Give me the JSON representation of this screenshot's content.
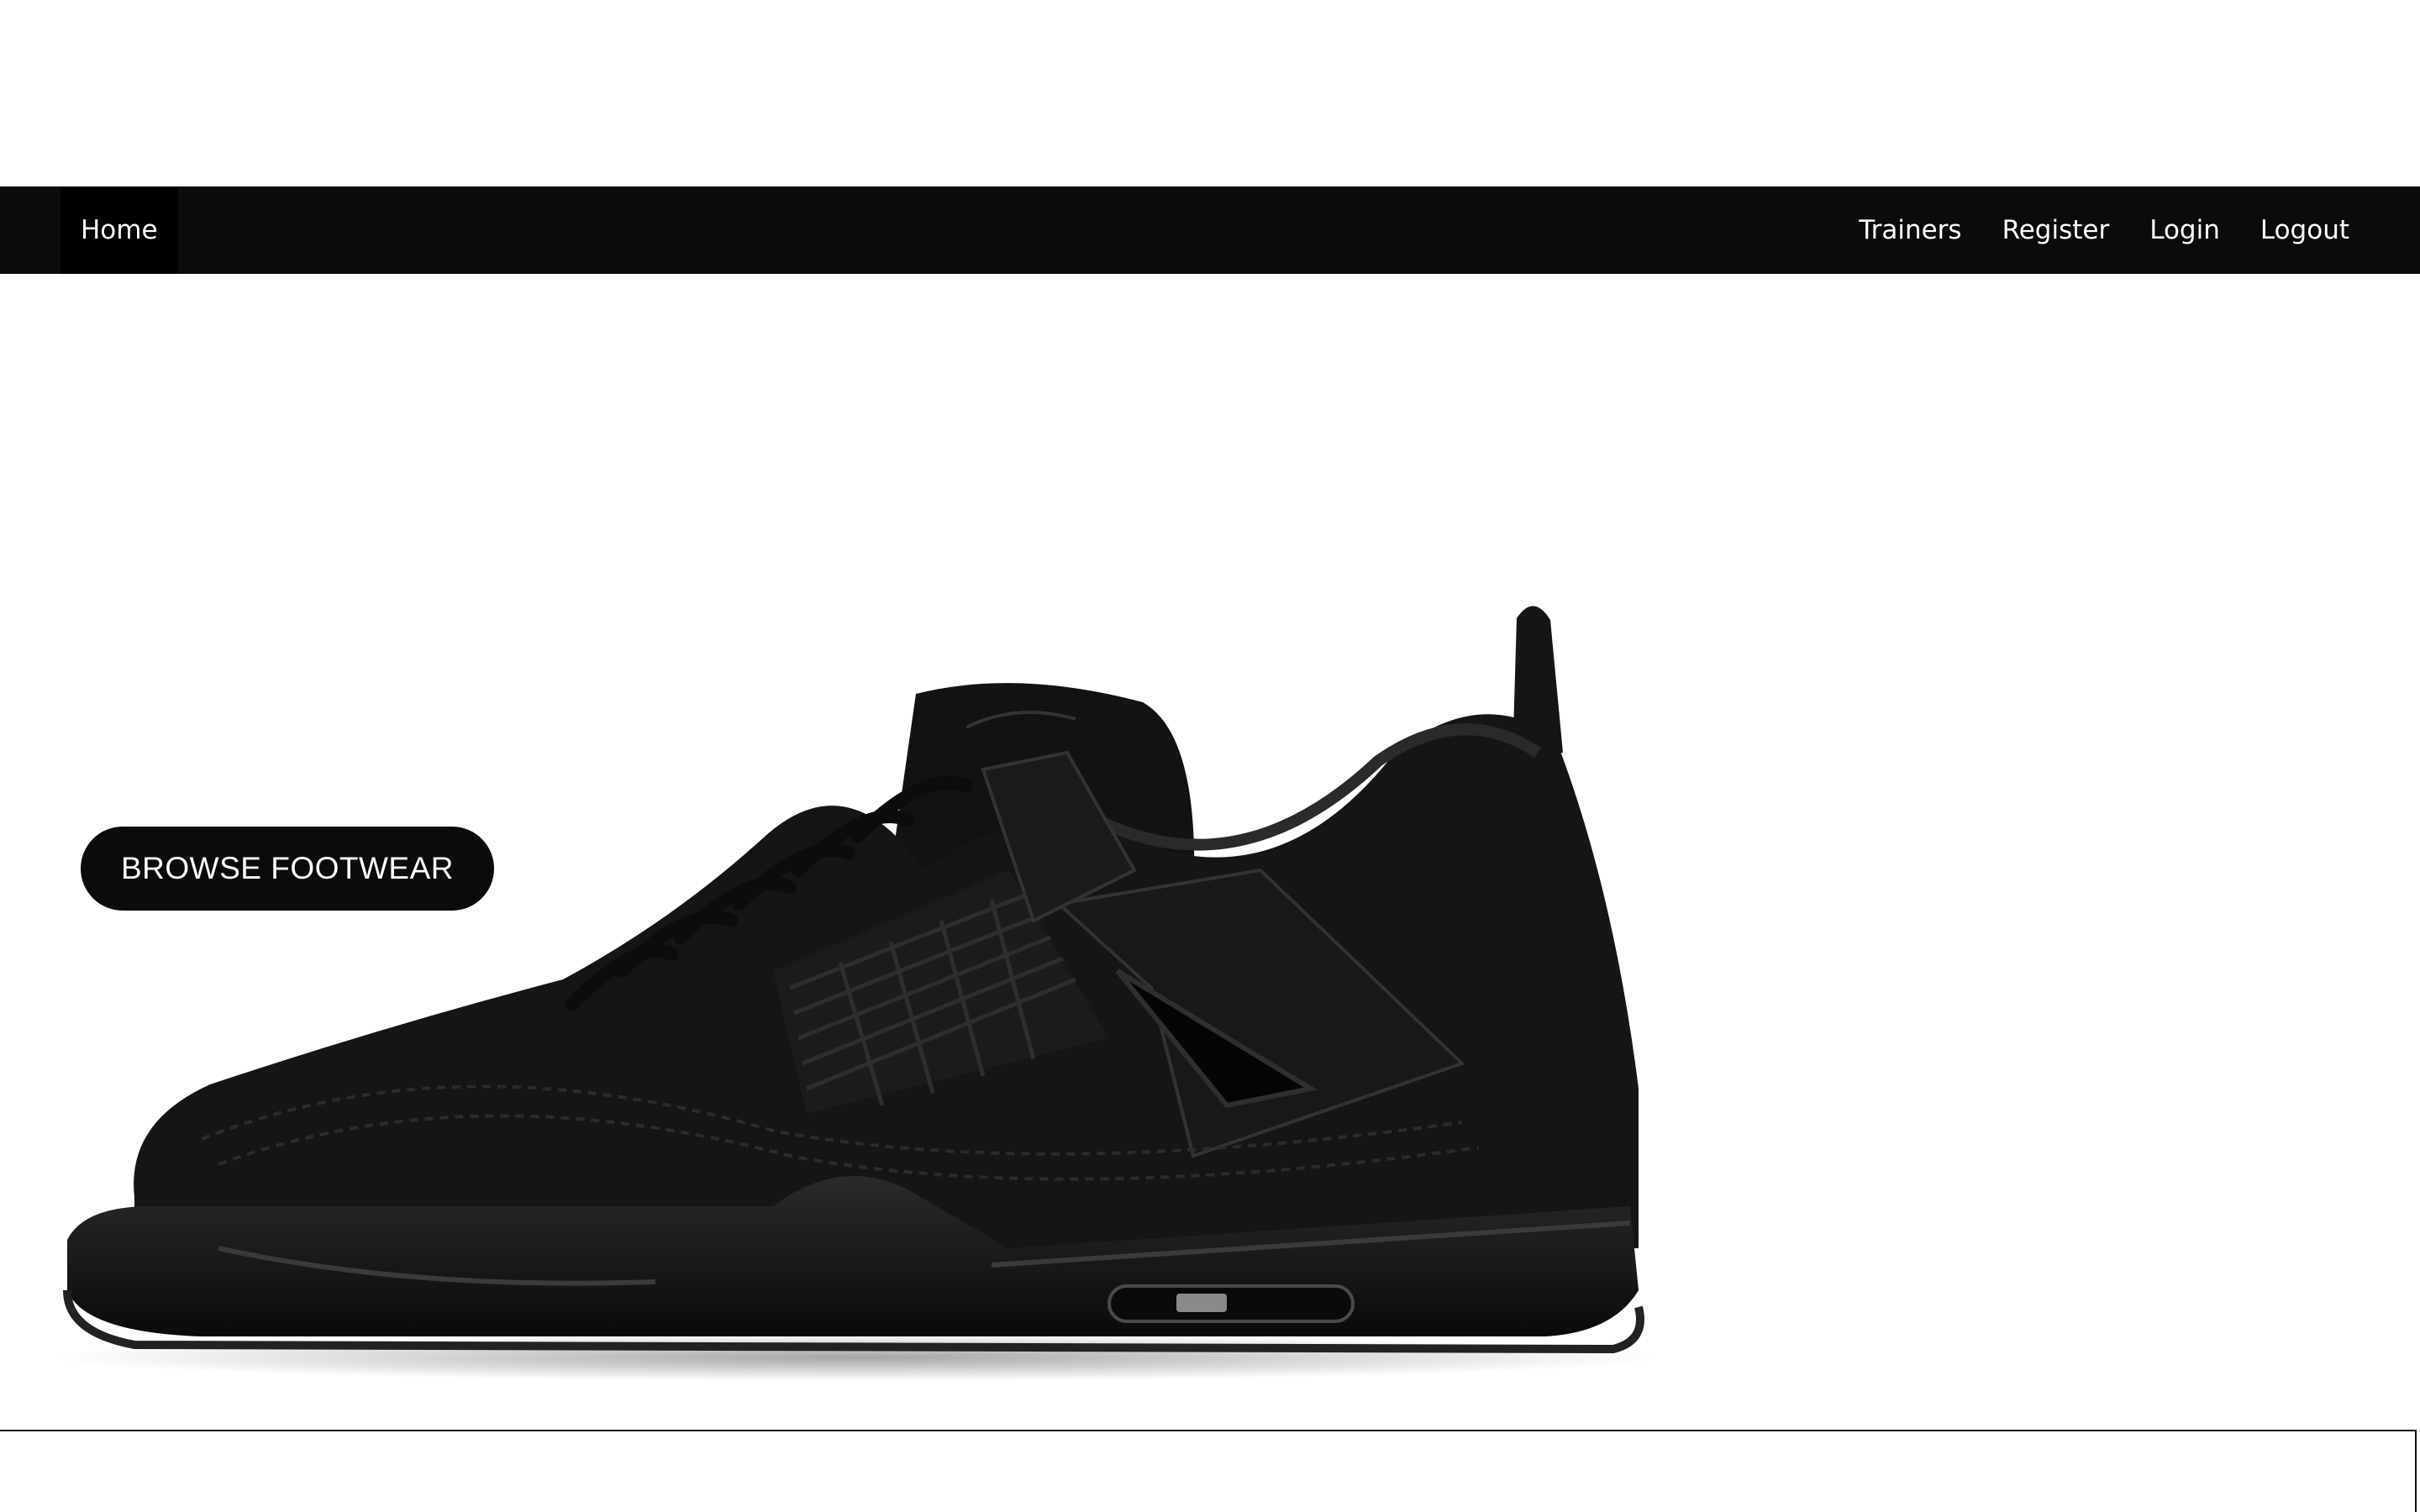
{
  "navbar": {
    "home_label": "Home",
    "links": [
      {
        "label": "Trainers"
      },
      {
        "label": "Register"
      },
      {
        "label": "Login"
      },
      {
        "label": "Logout"
      }
    ]
  },
  "hero": {
    "button_label": "BROWSE FOOTWEAR",
    "image_subject": "black high-top basketball sneaker"
  },
  "colors": {
    "nav_background": "#0b0b0b",
    "button_background": "#0b0b0b",
    "text_light": "#ffffff",
    "page_background": "#ffffff"
  }
}
